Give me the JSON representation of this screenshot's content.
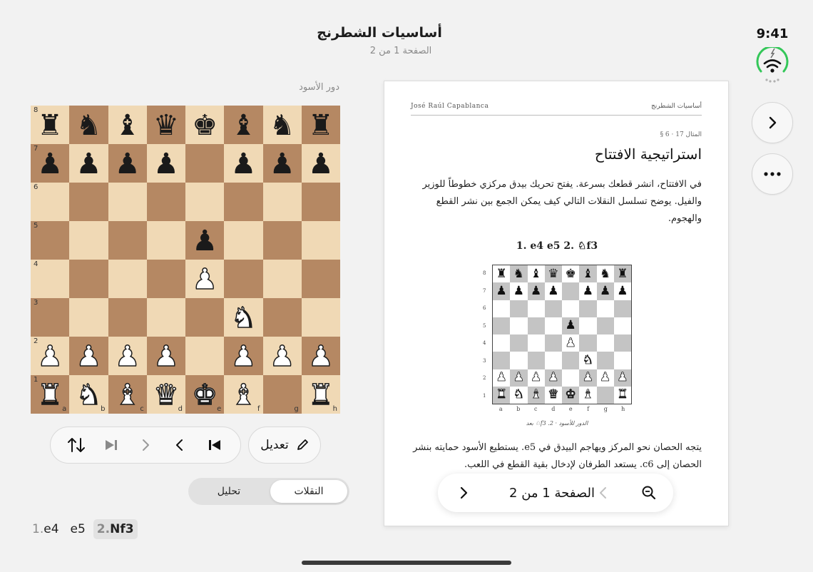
{
  "header": {
    "title": "أساسيات الشطرنج",
    "subtitle": "الصفحة 1 من 2"
  },
  "status": {
    "time": "9:41",
    "icons": [
      "wifi-icon",
      "charging-ring-icon"
    ],
    "accent": "#34c759"
  },
  "side_buttons": {
    "next_icon": "chevron-right-icon",
    "more_icon": "ellipsis-icon"
  },
  "board_panel": {
    "turn_label": "دور الأسود",
    "files": [
      "a",
      "b",
      "c",
      "d",
      "e",
      "f",
      "g",
      "h"
    ],
    "ranks": [
      "8",
      "7",
      "6",
      "5",
      "4",
      "3",
      "2",
      "1"
    ],
    "position": [
      [
        "r",
        "n",
        "b",
        "q",
        "k",
        "b",
        "n",
        "r"
      ],
      [
        "p",
        "p",
        "p",
        "p",
        "",
        "p",
        "p",
        "p"
      ],
      [
        "",
        "",
        "",
        "",
        "",
        "",
        "",
        ""
      ],
      [
        "",
        "",
        "",
        "",
        "p",
        "",
        "",
        ""
      ],
      [
        "",
        "",
        "",
        "",
        "P",
        "",
        "",
        ""
      ],
      [
        "",
        "",
        "",
        "",
        "",
        "N",
        "",
        ""
      ],
      [
        "P",
        "P",
        "P",
        "P",
        "",
        "P",
        "P",
        "P"
      ],
      [
        "R",
        "N",
        "B",
        "Q",
        "K",
        "B",
        "",
        "R"
      ]
    ],
    "light_square": "#f0d9b5",
    "dark_square": "#b58863"
  },
  "controls": {
    "nav_icons": [
      "flip-board-icon",
      "end-icon",
      "forward-icon",
      "back-icon",
      "start-icon"
    ],
    "edit_label": "تعديل",
    "edit_icon": "pencil-icon"
  },
  "segment": {
    "options": [
      "النقلات",
      "تحليل"
    ],
    "selected": "النقلات"
  },
  "moves": [
    {
      "num": "1.",
      "san": "e4"
    },
    {
      "num": "",
      "san": "e5"
    },
    {
      "num": "2.",
      "san": "Nf3",
      "current": true
    }
  ],
  "book_page": {
    "running_head_left": "José Raúl Capablanca",
    "running_head_right": "أساسيات الشطرنج",
    "section_no": "§ 6 · المثال 17",
    "section_title": "استراتيجية الافتتاح",
    "paragraph1": "في الافتتاح، انشر قطعك بسرعة. يفتح تحريك بيدق مركزي خطوطاً للوزير والفيل. يوضح تسلسل النقلات التالي كيف يمكن الجمع بين نشر القطع والهجوم.",
    "move_line": "1.  e4  e5      2.  ♘f3",
    "caption": "بعد ♘f3 .2 · الدور للأسود",
    "paragraph2": "يتجه الحصان نحو المركز ويهاجم البيدق في e5. يستطيع الأسود حمايته بنشر الحصان إلى c6. يستعد الطرفان لإدخال بقية القطع في اللعب."
  },
  "pager": {
    "label": "الصفحة 1 من 2",
    "zoom_icon": "zoom-out-icon",
    "prev_icon": "chevron-left-icon",
    "next_icon": "chevron-right-icon"
  }
}
